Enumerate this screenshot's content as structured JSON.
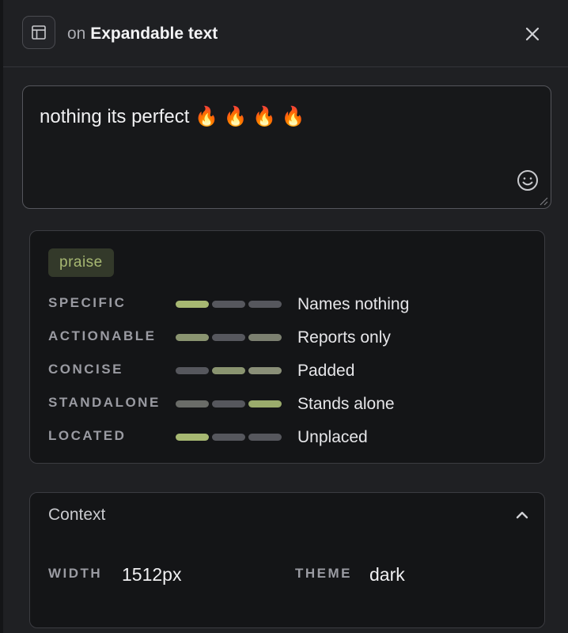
{
  "header": {
    "prefix": "on",
    "target": "Expandable text",
    "icon": "layout-icon",
    "close_icon": "close-icon"
  },
  "comment": {
    "text": "nothing its perfect 🔥 🔥 🔥 🔥",
    "emoji_icon": "smiley-icon"
  },
  "quality": {
    "tag": "praise",
    "metrics": [
      {
        "label": "SPECIFIC",
        "description": "Names nothing",
        "bars": [
          "#a7b872",
          "#56575d",
          "#56575d"
        ]
      },
      {
        "label": "ACTIONABLE",
        "description": "Reports only",
        "bars": [
          "#8a9470",
          "#56575d",
          "#7c8070"
        ]
      },
      {
        "label": "CONCISE",
        "description": "Padded",
        "bars": [
          "#56575d",
          "#8a9470",
          "#8a8f78"
        ]
      },
      {
        "label": "STANDALONE",
        "description": "Stands alone",
        "bars": [
          "#6a6c68",
          "#56575d",
          "#9aab6c"
        ]
      },
      {
        "label": "LOCATED",
        "description": "Unplaced",
        "bars": [
          "#a7b872",
          "#56575d",
          "#56575d"
        ]
      }
    ]
  },
  "context": {
    "title": "Context",
    "width_label": "WIDTH",
    "width_value": "1512px",
    "theme_label": "THEME",
    "theme_value": "dark"
  },
  "colors": {
    "background": "#1f2023",
    "card": "#141517",
    "accent_green": "#a7b872",
    "tag_bg": "#33392a"
  }
}
